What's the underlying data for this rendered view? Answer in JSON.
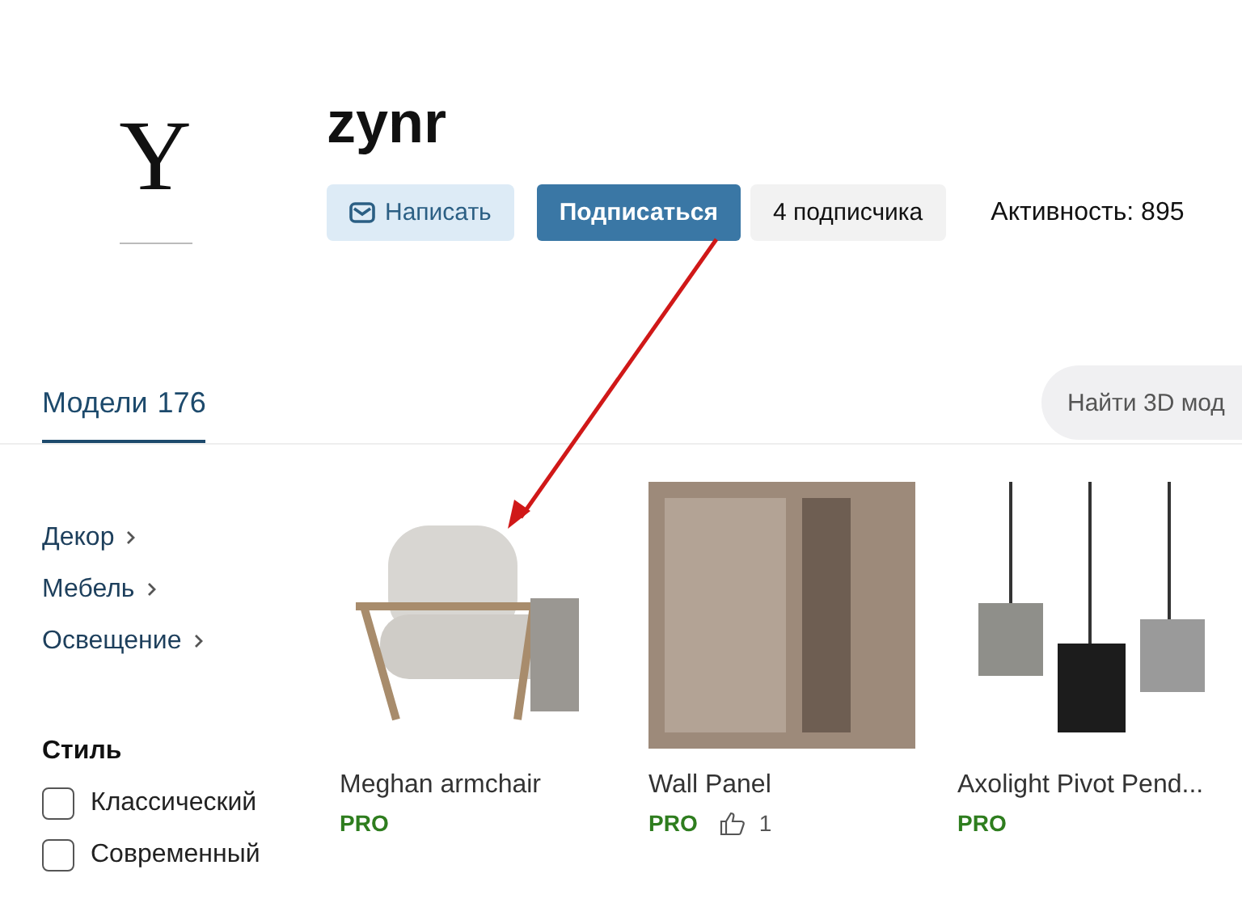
{
  "profile": {
    "logo_letter": "Y",
    "name": "zynr",
    "actions": [
      {
        "kind": "message",
        "label": "Написать"
      },
      {
        "kind": "subscribe",
        "label": "Подписаться"
      },
      {
        "kind": "count",
        "label": "4 подписчика"
      }
    ],
    "activity": "Активность: 895"
  },
  "tabs": [
    {
      "label": "Модели",
      "count": "176",
      "selected": true
    }
  ],
  "search": {
    "placeholder": "Найти 3D мод"
  },
  "categories": [
    {
      "label": "Декор"
    },
    {
      "label": "Мебель"
    },
    {
      "label": "Освещение"
    }
  ],
  "filters": {
    "title": "Стиль",
    "options": [
      {
        "label": "Классический",
        "checked": false
      },
      {
        "label": "Современный",
        "checked": false
      }
    ]
  },
  "models": [
    {
      "kind": "armchair",
      "name": "Meghan armchair",
      "badge": "PRO"
    },
    {
      "kind": "panel",
      "name": "Wall Panel",
      "badge": "PRO",
      "likes": "1"
    },
    {
      "kind": "lamps",
      "name": "Axolight Pivot Pend...",
      "badge": "PRO"
    }
  ]
}
